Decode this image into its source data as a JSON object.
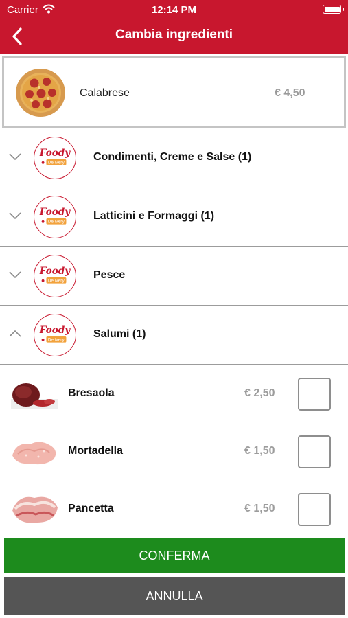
{
  "status_bar": {
    "carrier": "Carrier",
    "time": "12:14 PM"
  },
  "header": {
    "title": "Cambia ingredienti"
  },
  "product": {
    "name": "Calabrese",
    "price": "€ 4,50"
  },
  "logo": {
    "line1": "Foody",
    "line2": "Delivery"
  },
  "categories": [
    {
      "label": "Condimenti, Creme e Salse (1)",
      "expanded": false
    },
    {
      "label": "Latticini e Formaggi (1)",
      "expanded": false
    },
    {
      "label": "Pesce",
      "expanded": false
    },
    {
      "label": "Salumi (1)",
      "expanded": true
    }
  ],
  "items": [
    {
      "name": "Bresaola",
      "price": "€ 2,50",
      "checked": false
    },
    {
      "name": "Mortadella",
      "price": "€ 1,50",
      "checked": false
    },
    {
      "name": "Pancetta",
      "price": "€ 1,50",
      "checked": false
    }
  ],
  "actions": {
    "confirm": "CONFERMA",
    "cancel": "ANNULLA"
  },
  "colors": {
    "brand": "#c8172e",
    "confirm": "#1d8b1d",
    "cancel": "#555555"
  }
}
